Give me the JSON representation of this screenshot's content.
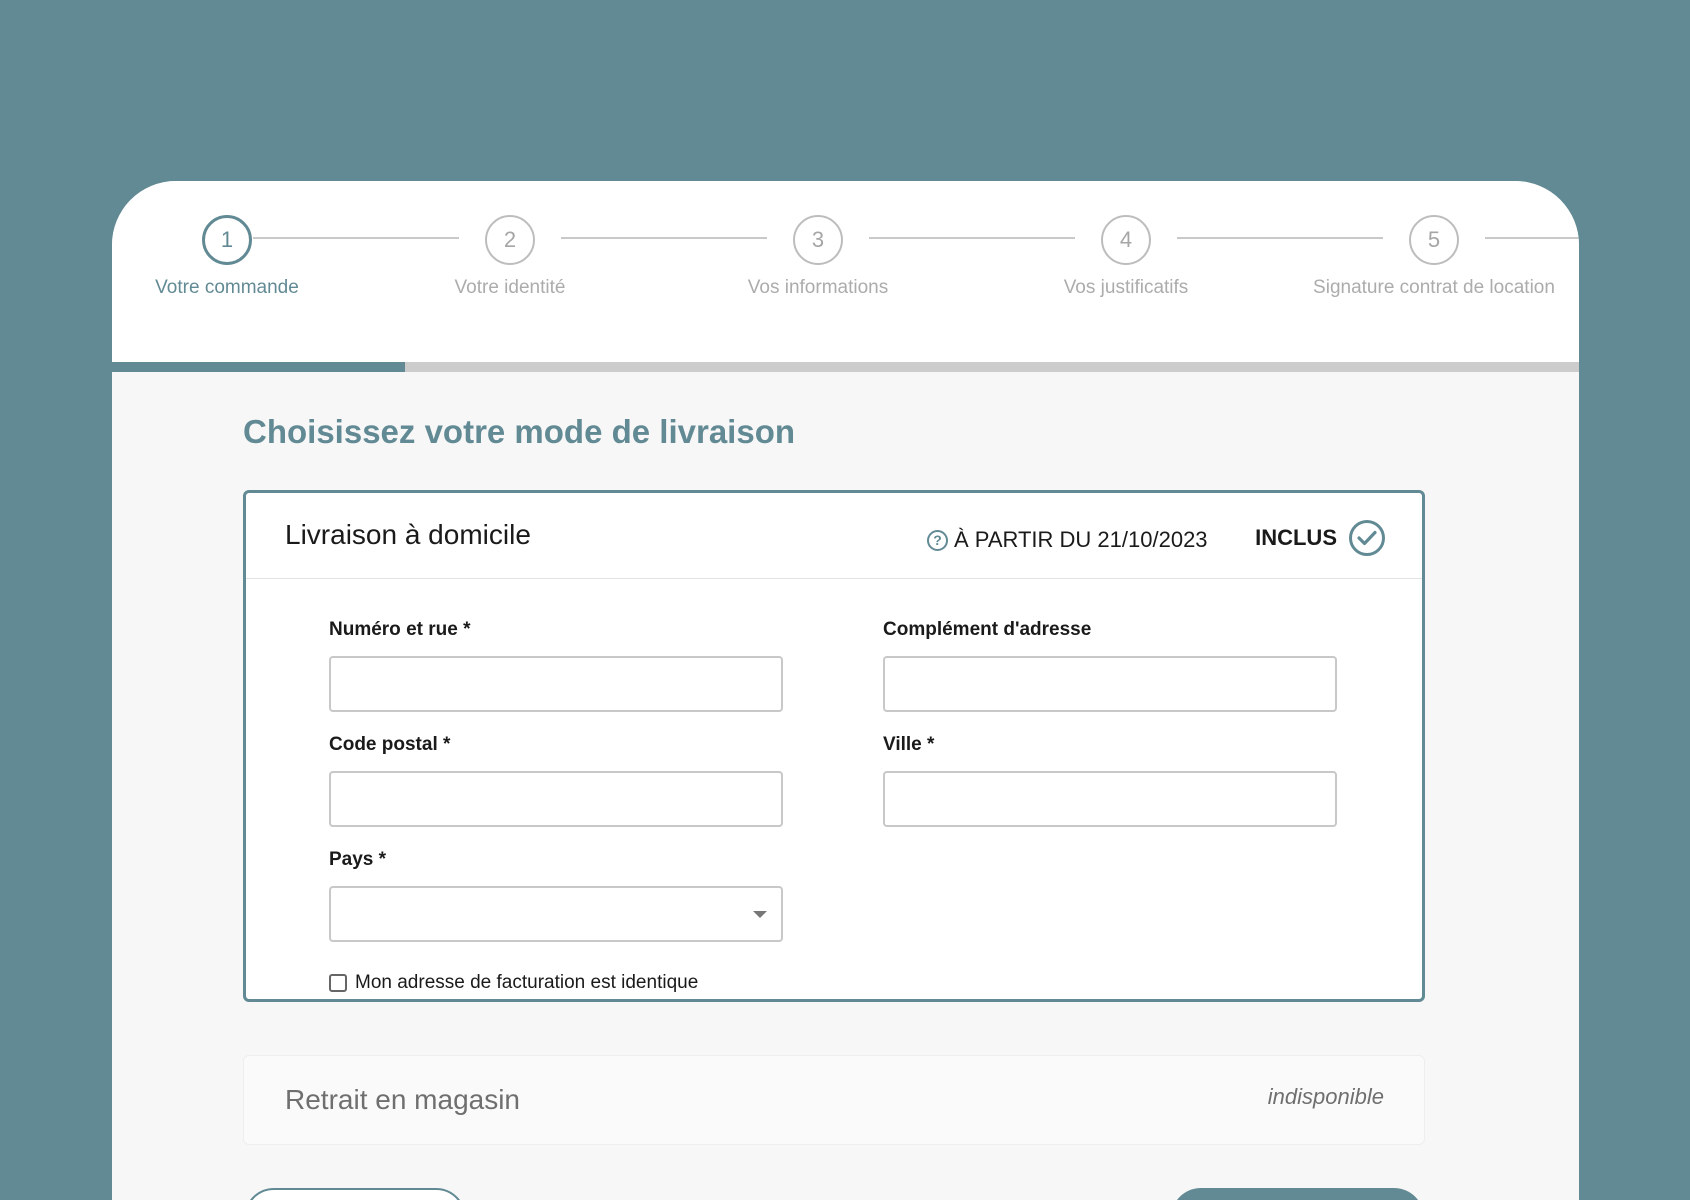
{
  "stepper": {
    "steps": [
      {
        "number": "1",
        "label": "Votre commande"
      },
      {
        "number": "2",
        "label": "Votre identité"
      },
      {
        "number": "3",
        "label": "Vos informations"
      },
      {
        "number": "4",
        "label": "Vos justificatifs"
      },
      {
        "number": "5",
        "label": "Signature contrat de location"
      }
    ],
    "active_step": 1,
    "progress": 0.2
  },
  "page": {
    "title": "Choisissez votre mode de livraison"
  },
  "delivery_home": {
    "title": "Livraison à domicile",
    "availability": "À PARTIR DU 21/10/2023",
    "price": "INCLUS",
    "selected": true,
    "fields": {
      "street_label": "Numéro et rue *",
      "street_value": "",
      "complement_label": "Complément d'adresse",
      "complement_value": "",
      "postal_label": "Code postal *",
      "postal_value": "",
      "city_label": "Ville *",
      "city_value": "",
      "country_label": "Pays *",
      "country_value": ""
    },
    "billing_checkbox_label": "Mon adresse de facturation est identique",
    "billing_checkbox_checked": false
  },
  "delivery_store": {
    "title": "Retrait en magasin",
    "status": "indisponible"
  },
  "colors": {
    "accent": "#628a94",
    "background": "#628a94",
    "muted_text": "#acacac"
  }
}
